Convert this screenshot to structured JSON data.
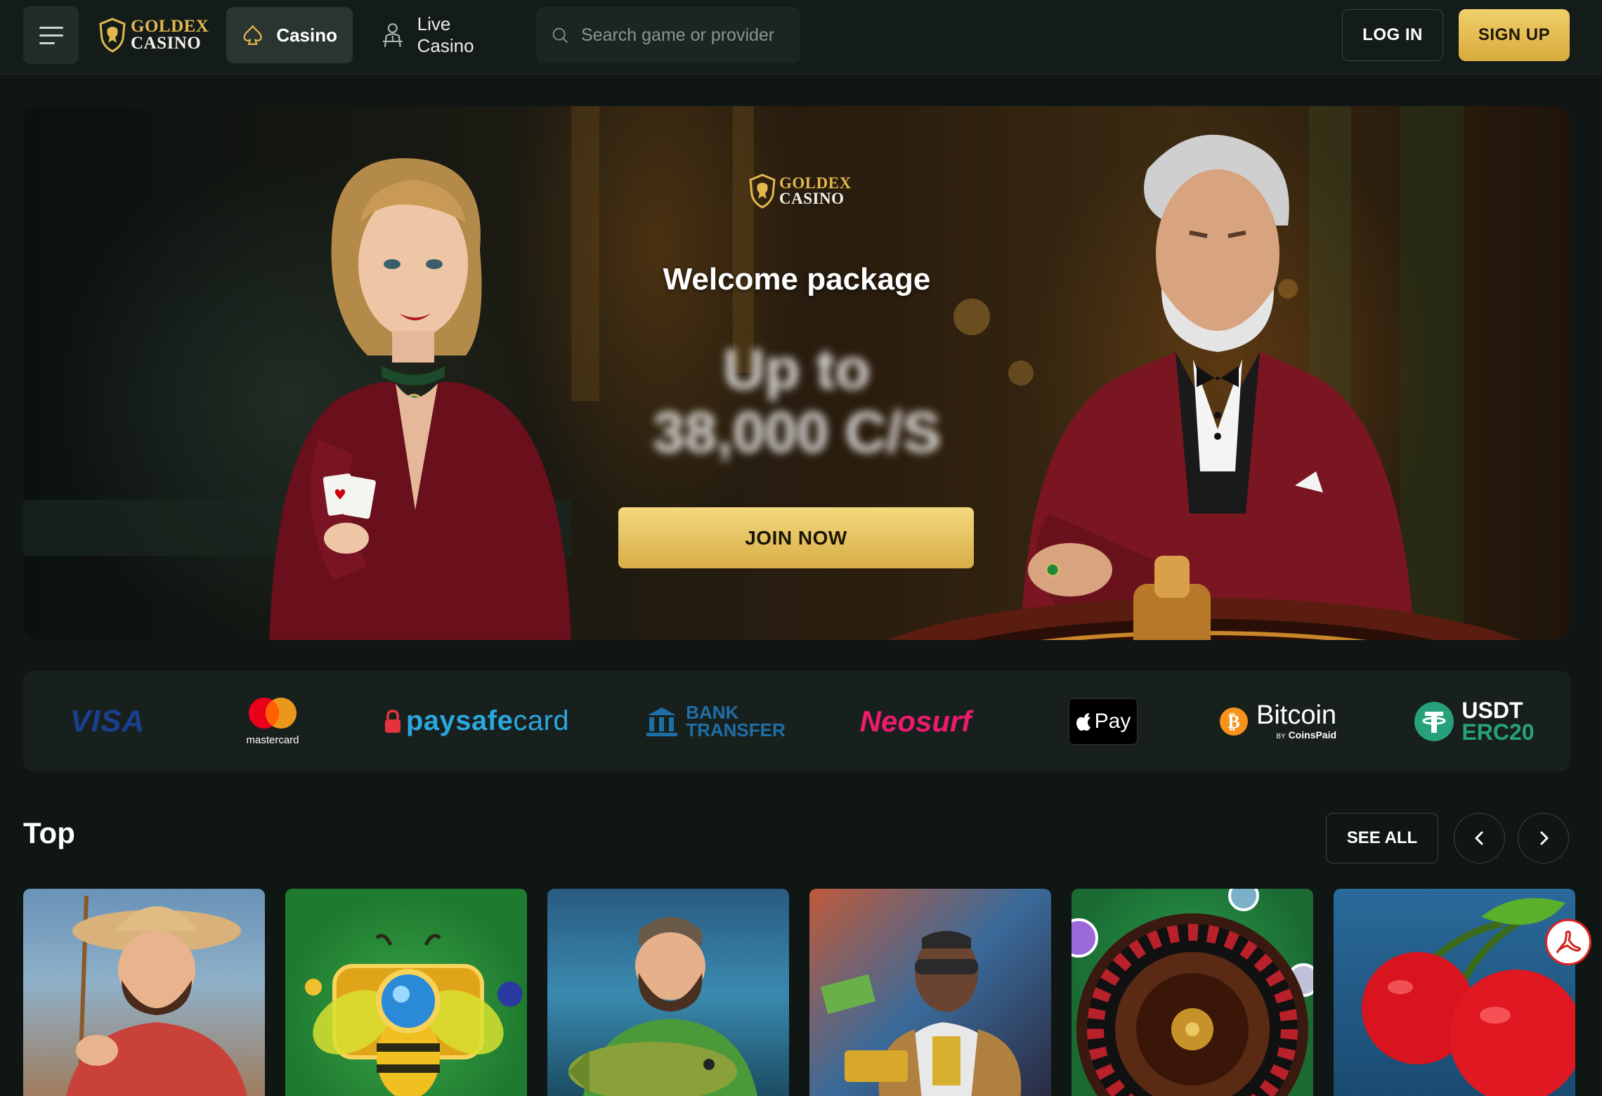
{
  "header": {
    "logo_line1": "GOLDEX",
    "logo_line2": "CASINO",
    "nav": {
      "casino": "Casino",
      "live_casino": "Live Casino"
    },
    "search_placeholder": "Search game or provider",
    "login_label": "LOG IN",
    "signup_label": "SIGN UP"
  },
  "hero": {
    "logo_line1": "GOLDEX",
    "logo_line2": "CASINO",
    "title": "Welcome package",
    "amount_line1": "Up to",
    "amount_line2": "38,000 C/S",
    "cta_label": "JOIN NOW"
  },
  "payments": {
    "visa": "VISA",
    "mastercard": "mastercard",
    "paysafe_a": "paysafe",
    "paysafe_b": "card",
    "bank_line1": "BANK",
    "bank_line2": "TRANSFER",
    "neosurf": "Neosurf",
    "applepay": "Pay",
    "bitcoin": "Bitcoin",
    "bitcoin_by": "BY",
    "coinspaid": "CoinsPaid",
    "usdt_line1": "USDT",
    "usdt_line2": "ERC20"
  },
  "top_section": {
    "title": "Top",
    "see_all_label": "SEE ALL"
  },
  "colors": {
    "background": "#0f1614",
    "accent_gold": "#e2b84d",
    "panel": "#18201e"
  }
}
